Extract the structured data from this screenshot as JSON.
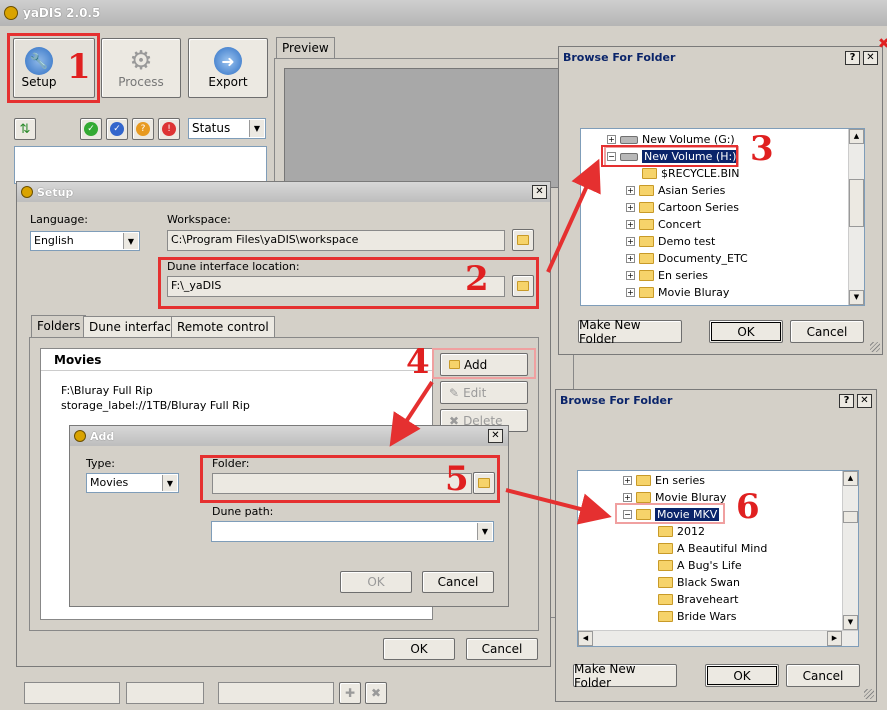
{
  "app": {
    "title": "yaDIS 2.0.5"
  },
  "toolbar": {
    "setup": "Setup",
    "process": "Process",
    "export": "Export",
    "status": "Status"
  },
  "preview_tab": "Preview",
  "setup": {
    "title": "Setup",
    "language_label": "Language:",
    "language_value": "English",
    "workspace_label": "Workspace:",
    "workspace_value": "C:\\Program Files\\yaDIS\\workspace",
    "dune_label": "Dune interface location:",
    "dune_value": "F:\\_yaDIS",
    "tabs": [
      "Folders",
      "Dune interface",
      "Remote control"
    ],
    "list_header": "Movies",
    "list_items": [
      "F:\\Bluray Full Rip",
      "storage_label://1TB/Bluray Full Rip"
    ],
    "add": "Add",
    "edit": "Edit",
    "delete": "Delete",
    "ok": "OK",
    "cancel": "Cancel"
  },
  "add_dialog": {
    "title": "Add",
    "type_label": "Type:",
    "type_value": "Movies",
    "folder_label": "Folder:",
    "folder_value": "",
    "dune_path_label": "Dune path:",
    "ok": "OK",
    "cancel": "Cancel"
  },
  "browse1": {
    "title": "Browse For Folder",
    "items": [
      "New Volume (G:)",
      "New Volume (H:)",
      "$RECYCLE.BIN",
      "Asian Series",
      "Cartoon Series",
      "Concert",
      "Demo test",
      "Documenty_ETC",
      "En series",
      "Movie Bluray"
    ],
    "make_new": "Make New Folder",
    "ok": "OK",
    "cancel": "Cancel"
  },
  "browse2": {
    "title": "Browse For Folder",
    "items": [
      "En series",
      "Movie Bluray",
      "Movie MKV",
      "2012",
      "A Beautiful Mind",
      "A Bug's Life",
      "Black Swan",
      "Braveheart",
      "Bride Wars"
    ],
    "make_new": "Make New Folder",
    "ok": "OK",
    "cancel": "Cancel"
  },
  "steps": [
    "1",
    "2",
    "3",
    "4",
    "5",
    "6"
  ],
  "colors": {
    "annotation_red": "#e53030",
    "selection_blue": "#0a246a"
  }
}
